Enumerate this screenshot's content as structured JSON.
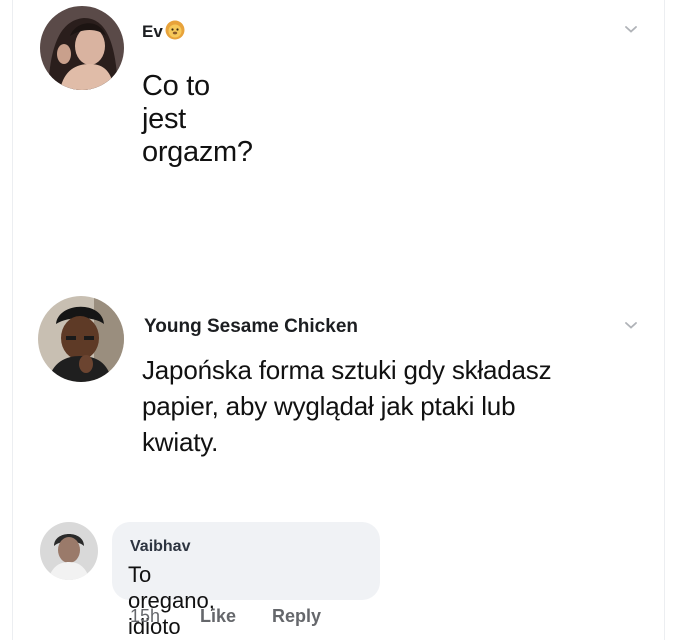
{
  "posts": [
    {
      "author": "Ev",
      "author_badge_icon": "lion-face-emoji",
      "text": "Co to jest orgazm?",
      "menu_icon": "chevron-down-icon"
    },
    {
      "author": "Young Sesame Chicken",
      "text": "Japońska forma sztuki gdy składasz papier, aby wyglądał jak ptaki lub kwiaty.",
      "menu_icon": "chevron-down-icon"
    }
  ],
  "reply": {
    "author": "Vaibhav",
    "text": "To oregano, idioto",
    "time": "15h",
    "like_label": "Like",
    "reply_label": "Reply"
  },
  "colors": {
    "meta_text": "#65676b",
    "bubble_bg": "#f0f2f5",
    "chevron": "#b0b3b8"
  }
}
